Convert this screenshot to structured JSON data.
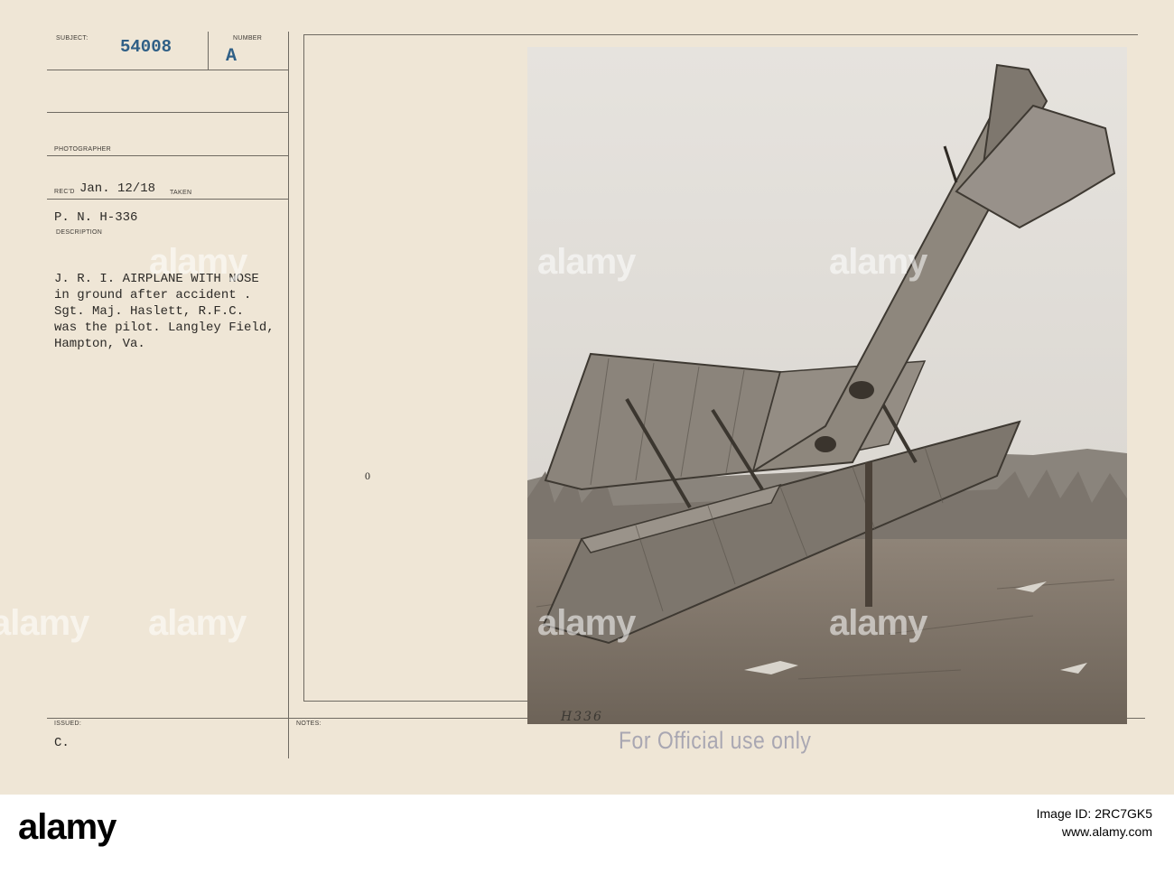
{
  "card": {
    "subject_label": "SUBJECT:",
    "subject_value": "54008",
    "number_label": "NUMBER",
    "number_value": "A",
    "photographer_label": "PHOTOGRAPHER",
    "recd_label": "REC'D",
    "recd_value": "Jan. 12/18",
    "taken_label": "TAKEN",
    "pn_value": "P. N. H-336",
    "description_label": "DESCRIPTION",
    "description_lines": [
      "J. R. I. AIRPLANE WITH NOSE",
      "in ground after accident .",
      "Sgt. Maj. Haslett, R.F.C.",
      "was the pilot. Langley Field,",
      "Hampton, Va."
    ],
    "issued_label": "ISSUED:",
    "issued_value": "C.",
    "notes_label": "NOTES:",
    "mark": "0"
  },
  "photo": {
    "negative_number": "H336",
    "official_stamp": "For Official use only"
  },
  "watermark_text": "alamy",
  "footer": {
    "logo": "alamy",
    "image_id_line": "Image ID: 2RC7GK5",
    "url": "www.alamy.com"
  },
  "colors": {
    "card": "#efe6d6",
    "stamp_blue": "#2f5f86",
    "official_stamp": "#a9a7b2"
  }
}
